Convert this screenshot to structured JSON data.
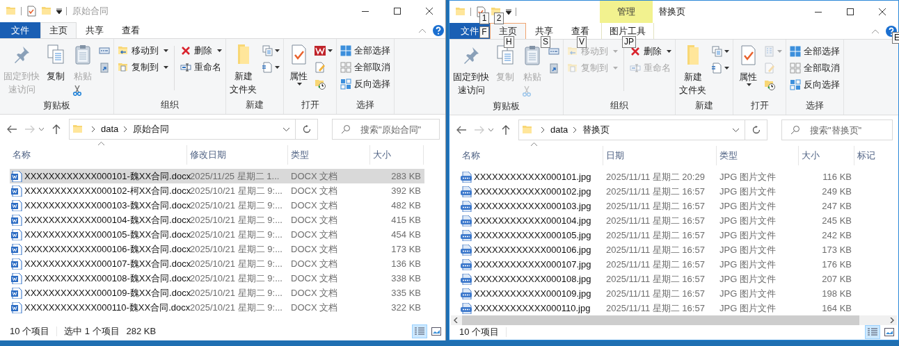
{
  "windows": [
    {
      "title": "原始合同",
      "active": false,
      "ribbon_tabs": [
        {
          "label": "文件",
          "kind": "file",
          "selected": false
        },
        {
          "label": "主页",
          "kind": "tab",
          "selected": true
        },
        {
          "label": "共享",
          "kind": "tab",
          "selected": false
        },
        {
          "label": "查看",
          "kind": "tab",
          "selected": false
        }
      ],
      "groups": [
        {
          "label": "剪贴板",
          "columns": [
            [
              {
                "kind": "big",
                "label": [
                  "固定到快",
                  "速访问"
                ],
                "disabled": true
              }
            ],
            [
              {
                "kind": "big",
                "label": "复制",
                "disabled": false
              }
            ],
            [
              {
                "kind": "big",
                "label": "粘贴",
                "disabled": true
              },
              {
                "kind": "icon",
                "disabled": false
              }
            ],
            [
              {
                "kind": "icon",
                "disabled": false
              },
              {
                "kind": "icon",
                "disabled": false
              }
            ]
          ]
        },
        {
          "label": "组织",
          "columns": [
            [
              {
                "kind": "small",
                "label": "移动到",
                "caret": true,
                "disabled": false
              },
              {
                "kind": "small",
                "label": "复制到",
                "caret": true,
                "disabled": false
              }
            ],
            [
              {
                "kind": "small",
                "label": "删除",
                "caret": true,
                "disabled": false
              },
              {
                "kind": "small",
                "label": "重命名",
                "caret": false,
                "disabled": false
              }
            ]
          ]
        },
        {
          "label": "新建",
          "columns": [
            [
              {
                "kind": "big",
                "label": [
                  "新建",
                  "文件夹"
                ],
                "disabled": false
              }
            ],
            [
              {
                "kind": "icon",
                "caret": true,
                "disabled": false
              },
              {
                "kind": "icon",
                "caret": true,
                "disabled": false
              }
            ]
          ]
        },
        {
          "label": "打开",
          "columns": [
            [
              {
                "kind": "big",
                "label": "属性",
                "caret": true,
                "disabled": false
              }
            ],
            [
              {
                "kind": "icon",
                "caret": true,
                "disabled": false
              },
              {
                "kind": "icon",
                "disabled": false
              },
              {
                "kind": "icon",
                "disabled": false
              }
            ]
          ]
        },
        {
          "label": "选择",
          "columns": [
            [
              {
                "kind": "small",
                "label": "全部选择",
                "disabled": false
              },
              {
                "kind": "small",
                "label": "全部取消",
                "disabled": false
              },
              {
                "kind": "small",
                "label": "反向选择",
                "disabled": false
              }
            ]
          ]
        }
      ],
      "path": [
        "data",
        "原始合同"
      ],
      "search_placeholder": "搜索\"原始合同\"",
      "columns": [
        {
          "label": "名称",
          "sorted": true
        },
        {
          "label": "修改日期",
          "sorted": false
        },
        {
          "label": "类型",
          "sorted": false
        },
        {
          "label": "大小",
          "sorted": false
        }
      ],
      "rows": [
        {
          "kind": "docx",
          "name": "XXXXXXXXXXXX000101-魏XX合同.docx",
          "date": "2025/11/25 星期二 1...",
          "type": "DOCX 文档",
          "size": "283 KB",
          "selected": true
        },
        {
          "kind": "docx",
          "name": "XXXXXXXXXXXX000102-柯XX合同.docx",
          "date": "2025/10/21 星期二 9:...",
          "type": "DOCX 文档",
          "size": "392 KB",
          "selected": false
        },
        {
          "kind": "docx",
          "name": "XXXXXXXXXXXX000103-魏XX合同.docx",
          "date": "2025/10/21 星期二 9:...",
          "type": "DOCX 文档",
          "size": "482 KB",
          "selected": false
        },
        {
          "kind": "docx",
          "name": "XXXXXXXXXXXX000104-魏XX合同.docx",
          "date": "2025/10/21 星期二 9:...",
          "type": "DOCX 文档",
          "size": "415 KB",
          "selected": false
        },
        {
          "kind": "docx",
          "name": "XXXXXXXXXXXX000105-魏XX合同.docx",
          "date": "2025/10/21 星期二 9:...",
          "type": "DOCX 文档",
          "size": "454 KB",
          "selected": false
        },
        {
          "kind": "docx",
          "name": "XXXXXXXXXXXX000106-魏XX合同.docx",
          "date": "2025/10/21 星期二 9:...",
          "type": "DOCX 文档",
          "size": "173 KB",
          "selected": false
        },
        {
          "kind": "docx",
          "name": "XXXXXXXXXXXX000107-魏XX合同.docx",
          "date": "2025/10/21 星期二 9:...",
          "type": "DOCX 文档",
          "size": "136 KB",
          "selected": false
        },
        {
          "kind": "docx",
          "name": "XXXXXXXXXXXX000108-魏XX合同.docx",
          "date": "2025/10/21 星期二 9:...",
          "type": "DOCX 文档",
          "size": "338 KB",
          "selected": false
        },
        {
          "kind": "docx",
          "name": "XXXXXXXXXXXX000109-魏XX合同.docx",
          "date": "2025/10/21 星期二 9:...",
          "type": "DOCX 文档",
          "size": "335 KB",
          "selected": false
        },
        {
          "kind": "docx",
          "name": "XXXXXXXXXXXX000110-魏XX合同.docx",
          "date": "2025/10/21 星期二 9:...",
          "type": "DOCX 文档",
          "size": "322 KB",
          "selected": false
        }
      ],
      "horizontal_scrollbar": false,
      "status": [
        "10 个项目",
        "选中 1 个项目",
        "282 KB"
      ]
    },
    {
      "title": "替换页",
      "active": true,
      "context_header": "管理",
      "ribbon_tabs": [
        {
          "label": "文件",
          "kind": "file",
          "selected": false
        },
        {
          "label": "主页",
          "kind": "tab",
          "selected": true
        },
        {
          "label": "共享",
          "kind": "tab",
          "selected": false
        },
        {
          "label": "查看",
          "kind": "tab",
          "selected": false
        },
        {
          "label": "图片工具",
          "kind": "context",
          "selected": false
        }
      ],
      "keytips": [
        "F",
        "1",
        "2",
        "H",
        "S",
        "V",
        "JP",
        "E"
      ],
      "groups": [
        {
          "label": "剪贴板",
          "columns": [
            [
              {
                "kind": "big",
                "label": [
                  "固定到快",
                  "速访问"
                ],
                "disabled": false
              }
            ],
            [
              {
                "kind": "big",
                "label": "复制",
                "disabled": true
              }
            ],
            [
              {
                "kind": "big",
                "label": "粘贴",
                "disabled": true
              },
              {
                "kind": "icon",
                "disabled": true
              }
            ],
            [
              {
                "kind": "icon",
                "disabled": false
              },
              {
                "kind": "icon",
                "disabled": false
              }
            ]
          ]
        },
        {
          "label": "组织",
          "columns": [
            [
              {
                "kind": "small",
                "label": "移动到",
                "caret": true,
                "disabled": true
              },
              {
                "kind": "small",
                "label": "复制到",
                "caret": true,
                "disabled": true
              }
            ],
            [
              {
                "kind": "small",
                "label": "删除",
                "caret": true,
                "disabled": false
              },
              {
                "kind": "small",
                "label": "重命名",
                "caret": false,
                "disabled": true
              }
            ]
          ]
        },
        {
          "label": "新建",
          "columns": [
            [
              {
                "kind": "big",
                "label": [
                  "新建",
                  "文件夹"
                ],
                "disabled": false
              }
            ],
            [
              {
                "kind": "icon",
                "caret": true,
                "disabled": false
              },
              {
                "kind": "icon",
                "caret": true,
                "disabled": false
              }
            ]
          ]
        },
        {
          "label": "打开",
          "columns": [
            [
              {
                "kind": "big",
                "label": "属性",
                "caret": true,
                "disabled": false
              }
            ],
            [
              {
                "kind": "icon",
                "caret": true,
                "disabled": true
              },
              {
                "kind": "icon",
                "disabled": true
              },
              {
                "kind": "icon",
                "disabled": false
              }
            ]
          ]
        },
        {
          "label": "选择",
          "columns": [
            [
              {
                "kind": "small",
                "label": "全部选择",
                "disabled": false
              },
              {
                "kind": "small",
                "label": "全部取消",
                "disabled": false
              },
              {
                "kind": "small",
                "label": "反向选择",
                "disabled": false
              }
            ]
          ]
        }
      ],
      "path": [
        "data",
        "替换页"
      ],
      "search_placeholder": "搜索\"替换页\"",
      "columns": [
        {
          "label": "名称",
          "sorted": true
        },
        {
          "label": "日期",
          "sorted": false
        },
        {
          "label": "类型",
          "sorted": false
        },
        {
          "label": "大小",
          "sorted": false
        },
        {
          "label": "标记",
          "sorted": false
        }
      ],
      "rows": [
        {
          "kind": "jpg",
          "name": "XXXXXXXXXXXX000101.jpg",
          "date": "2025/11/11 星期二 20:29",
          "type": "JPG 图片文件",
          "size": "116 KB",
          "selected": false
        },
        {
          "kind": "jpg",
          "name": "XXXXXXXXXXXX000102.jpg",
          "date": "2025/11/11 星期二 16:57",
          "type": "JPG 图片文件",
          "size": "249 KB",
          "selected": false
        },
        {
          "kind": "jpg",
          "name": "XXXXXXXXXXXX000103.jpg",
          "date": "2025/11/11 星期二 16:57",
          "type": "JPG 图片文件",
          "size": "247 KB",
          "selected": false
        },
        {
          "kind": "jpg",
          "name": "XXXXXXXXXXXX000104.jpg",
          "date": "2025/11/11 星期二 16:57",
          "type": "JPG 图片文件",
          "size": "245 KB",
          "selected": false
        },
        {
          "kind": "jpg",
          "name": "XXXXXXXXXXXX000105.jpg",
          "date": "2025/11/11 星期二 16:57",
          "type": "JPG 图片文件",
          "size": "242 KB",
          "selected": false
        },
        {
          "kind": "jpg",
          "name": "XXXXXXXXXXXX000106.jpg",
          "date": "2025/11/11 星期二 16:57",
          "type": "JPG 图片文件",
          "size": "173 KB",
          "selected": false
        },
        {
          "kind": "jpg",
          "name": "XXXXXXXXXXXX000107.jpg",
          "date": "2025/11/11 星期二 16:57",
          "type": "JPG 图片文件",
          "size": "176 KB",
          "selected": false
        },
        {
          "kind": "jpg",
          "name": "XXXXXXXXXXXX000108.jpg",
          "date": "2025/11/11 星期二 16:57",
          "type": "JPG 图片文件",
          "size": "207 KB",
          "selected": false
        },
        {
          "kind": "jpg",
          "name": "XXXXXXXXXXXX000109.jpg",
          "date": "2025/11/11 星期二 16:57",
          "type": "JPG 图片文件",
          "size": "198 KB",
          "selected": false
        },
        {
          "kind": "jpg",
          "name": "XXXXXXXXXXXX000110.jpg",
          "date": "2025/11/11 星期二 16:57",
          "type": "JPG 图片文件",
          "size": "164 KB",
          "selected": false
        }
      ],
      "horizontal_scrollbar": true,
      "status": [
        "10 个项目"
      ]
    }
  ]
}
